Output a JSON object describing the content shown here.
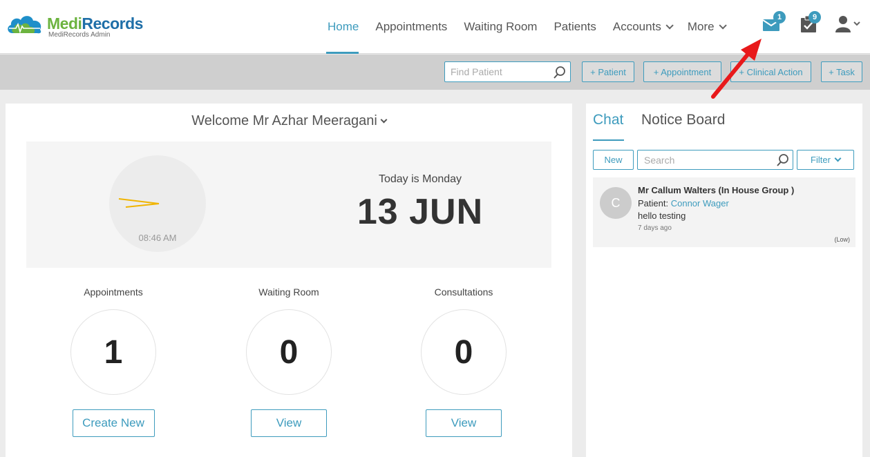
{
  "brand": {
    "name_part1": "Medi",
    "name_part2": "Records",
    "subtitle": "MediRecords Admin"
  },
  "nav": {
    "items": [
      {
        "label": "Home",
        "active": true
      },
      {
        "label": "Appointments"
      },
      {
        "label": "Waiting Room"
      },
      {
        "label": "Patients"
      },
      {
        "label": "Accounts",
        "dropdown": true
      },
      {
        "label": "More",
        "dropdown": true
      }
    ],
    "mail_badge": "1",
    "tasks_badge": "9"
  },
  "toolbar": {
    "find_placeholder": "Find Patient",
    "add_patient": "+ Patient",
    "add_appointment": "+ Appointment",
    "add_clinical_action": "+ Clinical Action",
    "add_task": "+ Task"
  },
  "dashboard": {
    "welcome": "Welcome Mr Azhar Meeragani",
    "clock_time": "08:46 AM",
    "today_label": "Today is Monday",
    "date": "13 JUN",
    "stats": [
      {
        "label": "Appointments",
        "value": "1",
        "button": "Create New"
      },
      {
        "label": "Waiting Room",
        "value": "0",
        "button": "View"
      },
      {
        "label": "Consultations",
        "value": "0",
        "button": "View"
      }
    ]
  },
  "side": {
    "tabs": [
      {
        "label": "Chat",
        "active": true
      },
      {
        "label": "Notice Board"
      }
    ],
    "new_button": "New",
    "search_placeholder": "Search",
    "filter_button": "Filter",
    "messages": [
      {
        "initial": "C",
        "sender": "Mr Callum Walters (In House Group )",
        "patient_label": "Patient:",
        "patient_name": "Connor Wager",
        "text": "hello testing",
        "time": "7 days ago",
        "priority": "(Low)"
      }
    ]
  },
  "colors": {
    "accent": "#3d9bbd",
    "brand_green": "#6cb33f",
    "brand_blue": "#1f6fa8",
    "clock_hand": "#f0b400",
    "arrow": "#e8191b"
  }
}
